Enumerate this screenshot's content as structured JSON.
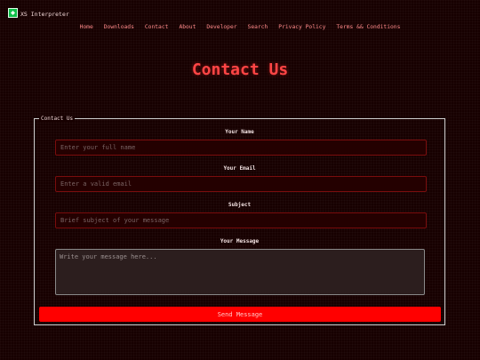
{
  "brand": {
    "name": "XS Interpreter",
    "icon": "app-logo-icon"
  },
  "nav": {
    "items": [
      "Home",
      "Downloads",
      "Contact",
      "About",
      "Developer",
      "Search",
      "Privacy Policy",
      "Terms && Conditions"
    ]
  },
  "page": {
    "title": "Contact Us"
  },
  "form": {
    "legend": "Contact Us",
    "name_label": "Your Name",
    "name_placeholder": "Enter your full name",
    "email_label": "Your Email",
    "email_placeholder": "Enter a valid email",
    "subject_label": "Subject",
    "subject_placeholder": "Brief subject of your message",
    "message_label": "Your Message",
    "message_placeholder": "Write your message here...",
    "submit_label": "Send Message"
  },
  "colors": {
    "background": "#170000",
    "accent": "#ff0000",
    "title": "#ff4545",
    "nav_link": "#ff8a8a"
  }
}
